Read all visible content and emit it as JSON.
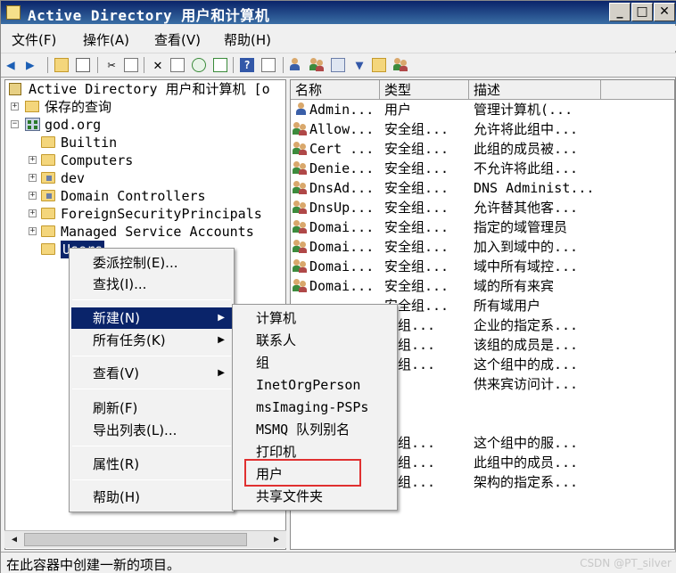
{
  "window": {
    "title": "Active Directory 用户和计算机"
  },
  "menubar": [
    {
      "label": "文件(F)"
    },
    {
      "label": "操作(A)"
    },
    {
      "label": "查看(V)"
    },
    {
      "label": "帮助(H)"
    }
  ],
  "tree": {
    "root": "Active Directory 用户和计算机 [o",
    "saved_queries": "保存的查询",
    "domain": "god.org",
    "children": [
      "Builtin",
      "Computers",
      "dev",
      "Domain Controllers",
      "ForeignSecurityPrincipals",
      "Managed Service Accounts",
      "Users"
    ]
  },
  "list": {
    "columns": [
      "名称",
      "类型",
      "描述"
    ],
    "rows": [
      {
        "name": "Admin...",
        "type": "用户",
        "desc": "管理计算机(...",
        "icon": "user-icon"
      },
      {
        "name": "Allow...",
        "type": "安全组...",
        "desc": "允许将此组中...",
        "icon": "group-icon"
      },
      {
        "name": "Cert ...",
        "type": "安全组...",
        "desc": "此组的成员被...",
        "icon": "group-icon"
      },
      {
        "name": "Denie...",
        "type": "安全组...",
        "desc": "不允许将此组...",
        "icon": "group-icon"
      },
      {
        "name": "DnsAd...",
        "type": "安全组...",
        "desc": "DNS Administ...",
        "icon": "group-icon"
      },
      {
        "name": "DnsUp...",
        "type": "安全组...",
        "desc": "允许替其他客...",
        "icon": "group-icon"
      },
      {
        "name": "Domai...",
        "type": "安全组...",
        "desc": "指定的域管理员",
        "icon": "group-icon"
      },
      {
        "name": "Domai...",
        "type": "安全组...",
        "desc": "加入到域中的...",
        "icon": "group-icon"
      },
      {
        "name": "Domai...",
        "type": "安全组...",
        "desc": "域中所有域控...",
        "icon": "group-icon"
      },
      {
        "name": "Domai...",
        "type": "安全组...",
        "desc": "域的所有来宾",
        "icon": "group-icon"
      },
      {
        "name": "",
        "type": "安全组...",
        "desc": "所有域用户",
        "icon": ""
      },
      {
        "name": "",
        "type": "全组...",
        "desc": "企业的指定系...",
        "icon": ""
      },
      {
        "name": "",
        "type": "全组...",
        "desc": "该组的成员是...",
        "icon": ""
      },
      {
        "name": "",
        "type": "全组...",
        "desc": "这个组中的成...",
        "icon": ""
      },
      {
        "name": "",
        "type": "户",
        "desc": "供来宾访问计...",
        "icon": ""
      },
      {
        "name": "",
        "type": "户",
        "desc": "",
        "icon": ""
      },
      {
        "name": "",
        "type": "户",
        "desc": "",
        "icon": ""
      },
      {
        "name": "",
        "type": "全组...",
        "desc": "这个组中的服...",
        "icon": ""
      },
      {
        "name": "",
        "type": "全组...",
        "desc": "此组中的成员...",
        "icon": ""
      },
      {
        "name": "",
        "type": "全组...",
        "desc": "架构的指定系...",
        "icon": ""
      }
    ]
  },
  "context_menu": {
    "items": [
      "委派控制(E)...",
      "查找(I)...",
      "新建(N)",
      "所有任务(K)",
      "查看(V)",
      "刷新(F)",
      "导出列表(L)...",
      "属性(R)",
      "帮助(H)"
    ]
  },
  "submenu": {
    "items": [
      "计算机",
      "联系人",
      "组",
      "InetOrgPerson",
      "msImaging-PSPs",
      "MSMQ 队列别名",
      "打印机",
      "用户",
      "共享文件夹"
    ]
  },
  "status": {
    "text": "在此容器中创建一新的项目。"
  },
  "watermark": "CSDN @PT_silver"
}
